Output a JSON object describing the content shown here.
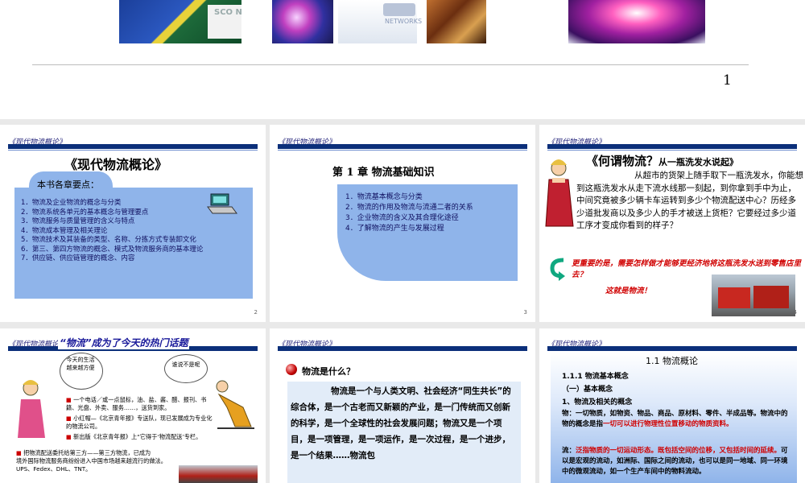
{
  "top_slide": {
    "page_number": "1",
    "thumbnails": [
      {
        "name": "cisco-networks-image",
        "caption": "SCO  NETWORKS"
      },
      {
        "name": "fiber-optic-image"
      },
      {
        "name": "network-people-image",
        "caption": "NETWORKS"
      },
      {
        "name": "colorful-lights-image"
      }
    ]
  },
  "slides": [
    {
      "header": "《现代物流概论》",
      "title": "《现代物流概论》",
      "subtitle": "本书各章要点：",
      "items": [
        "1．物流及企业物流的概念与分类",
        "2．物流系统各单元的基本概念与管理要点",
        "3．物流服务与质量管理的含义与特点",
        "4．物流成本管理及相关理论",
        "5．物流技术及其装备的类型、名称、分拣方式专装卸文化",
        "6．第三、第四方物流的概念、模式及物流服务商的基本理论",
        "7．供应链、供应链管理的概念、内容"
      ],
      "number": "2"
    },
    {
      "header": "《现代物流概论》",
      "title": "第 1 章  物流基础知识",
      "items": [
        "1．物流基本概念与分类",
        "2．物流的作用及物流与流通二者的关系",
        "3．企业物流的含义及其合理化途径",
        "4．了解物流的产生与发展过程"
      ],
      "number": "3"
    },
    {
      "header": "《现代物流概论》",
      "title": "《何谓物流？",
      "title_small": "从一瓶洗发水说起》",
      "body": "从超市的货架上随手取下一瓶洗发水，你能想到这瓶洗发水从走下流水线那一刻起，到你拿到手中为止，中间究竟被多少辆卡车运转到多少个物流配送中心？历经多少道批发商以及多少人的手才被送上货柜？它要经过多少道工序才变成你看到的样子？",
      "emphasis": "更重要的是，需要怎样做才能够更经济地将这瓶洗发水送到零售店里去？",
      "conclusion": "这就是物流！",
      "number": "4"
    },
    {
      "header": "《现代物流概论》",
      "title": "“物流”成为了今天的热门话题",
      "bubble_left": "今天的生活越来越方便",
      "bubble_right": "谁说不是呢",
      "bullets": [
        "一个电话／或一点鼠标，油、盐、酱、醋、报刊、书籍、光盘、外卖、服务……，送货到家。",
        "小红帽—《北京青年报》专送队，现已发展成为专业化的物流公司。",
        "新出版《北京青年报》上“它得于‘物流配送’专栏。",
        "把物流配送委托给第三方——第三方物流，已成为",
        "境外国际物流服务商纷纷进入中国市场越来越流行的做法。",
        "UPS、Fedex、DHL、TNT。"
      ]
    },
    {
      "header": "《现代物流概论》",
      "question": "物流是什么？",
      "body": "物流是一个与人类文明、社会经济“同生共长”的综合体，是一个古老而又新颖的产业，是一门传统而又创新的科学，是一个全球性的社会发展问题；物流又是一个项目，是一项管理，是一项运作，是一次过程，是一个进步，是一个结果……物流包"
    },
    {
      "header": "《现代物流概论》",
      "section_title": "1.1 物流概论",
      "sub1": "1.1.1  物流基本概念",
      "sub2": "（一）基本概念",
      "sub3": "1、物流及相关的概念",
      "wu_label": "物：",
      "wu_text": "一切物质，如物资、物品、商品、原材料、零件、半成品等。物流中的物的概念是指",
      "wu_red": "一切可以进行物理性位置移动的物质资料。",
      "liu_label": "流：",
      "liu_red": "泛指物质的一切运动形态。既包括空间的位移，又包括时间的延续。",
      "liu_text": "可以是宏观的流动，如洲际、国际之间的流动，也可以是同一地域、同一环境中的微观流动，如一个生产车间中的物料流动。"
    }
  ],
  "colors": {
    "header_bar": "#0b2f7a",
    "slide_blue_box": "#8fb4ea",
    "red_text": "#d00000",
    "background": "#e9e9e9"
  }
}
